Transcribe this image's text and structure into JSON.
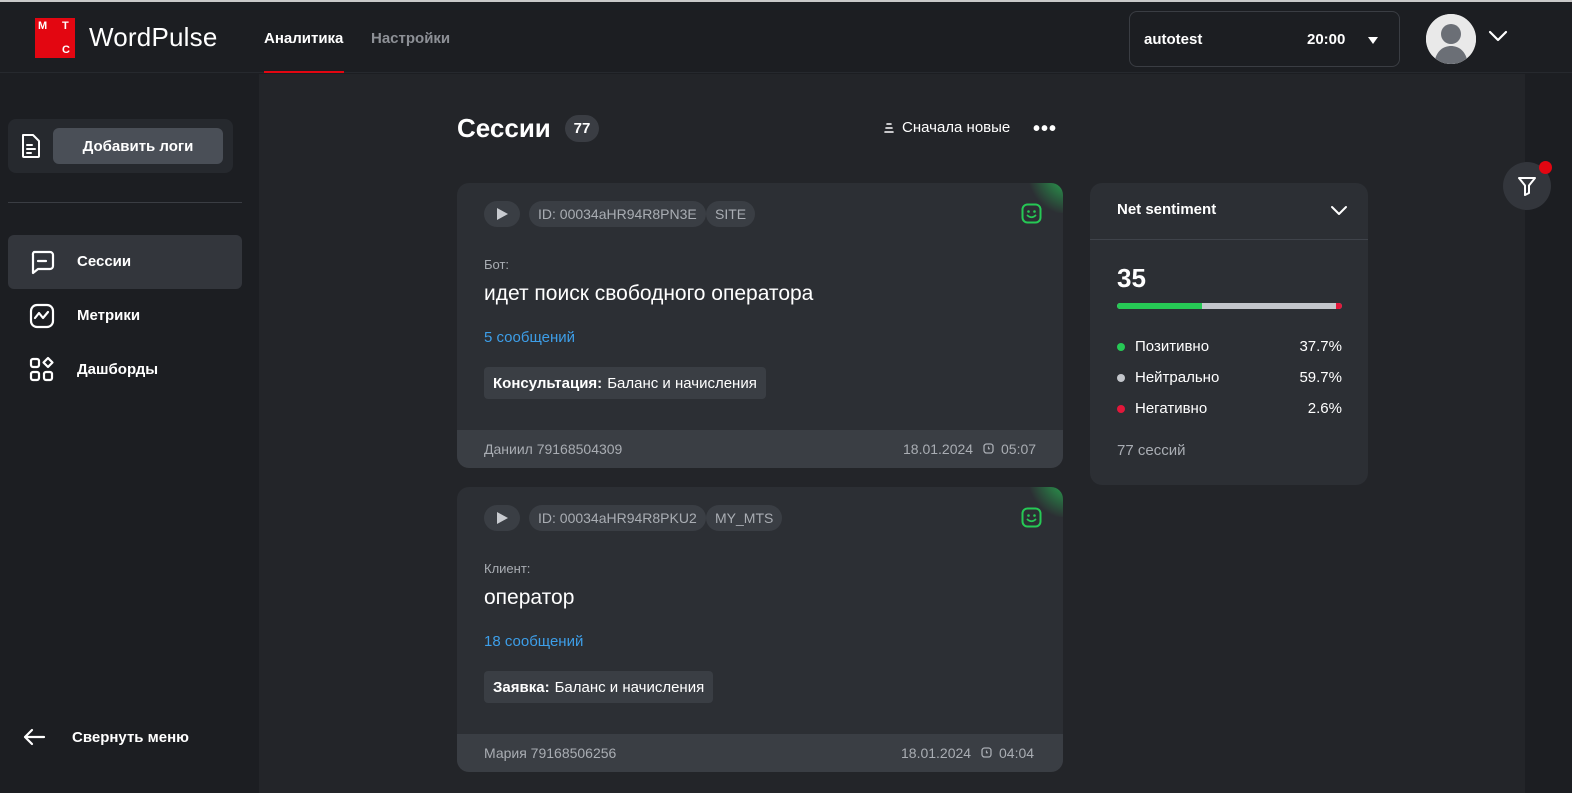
{
  "header": {
    "logo_letters": [
      "М",
      "Т",
      "С"
    ],
    "brand": "WordPulse",
    "tabs": [
      {
        "label": "Аналитика",
        "active": true
      },
      {
        "label": "Настройки",
        "active": false
      }
    ],
    "account": {
      "name": "autotest",
      "time": "20:00"
    },
    "accent_color": "#e30611"
  },
  "sidebar": {
    "add_logs_label": "Добавить логи",
    "items": [
      {
        "label": "Сессии",
        "icon": "chat-icon",
        "active": true
      },
      {
        "label": "Метрики",
        "icon": "metrics-icon",
        "active": false
      },
      {
        "label": "Дашборды",
        "icon": "dashboards-icon",
        "active": false
      }
    ],
    "collapse_label": "Свернуть меню"
  },
  "main": {
    "title": "Сессии",
    "count": "77",
    "sort_label": "Сначала новые",
    "more_label": "•••",
    "sessions": [
      {
        "id": "ID: 00034aHR94R8PN3E",
        "channel": "SITE",
        "speaker": "Бот:",
        "message": "идет поиск свободного оператора",
        "messages_count": "5 сообщений",
        "topic_type": "Консультация:",
        "topic": "Баланс и начисления",
        "user": "Даниил 79168504309",
        "date": "18.01.2024",
        "time": "05:07",
        "sentiment": "positive"
      },
      {
        "id": "ID: 00034aHR94R8PKU2",
        "channel": "MY_MTS",
        "speaker": "Клиент:",
        "message": "оператор",
        "messages_count": "18 сообщений",
        "topic_type": "Заявка:",
        "topic": "Баланс и начисления",
        "user": "Мария 79168506256",
        "date": "18.01.2024",
        "time": "04:04",
        "sentiment": "positive"
      }
    ]
  },
  "sentiment_panel": {
    "title": "Net sentiment",
    "score": "35",
    "rows": [
      {
        "label": "Позитивно",
        "value": "37.7%",
        "fraction": 0.377,
        "color": "#26c955"
      },
      {
        "label": "Нейтрально",
        "value": "59.7%",
        "fraction": 0.597,
        "color": "#c3c6cb"
      },
      {
        "label": "Негативно",
        "value": "2.6%",
        "fraction": 0.026,
        "color": "#e3173a"
      }
    ],
    "sessions_label": "77 сессий"
  },
  "filter": {
    "icon": "filter-icon",
    "has_active": true
  }
}
